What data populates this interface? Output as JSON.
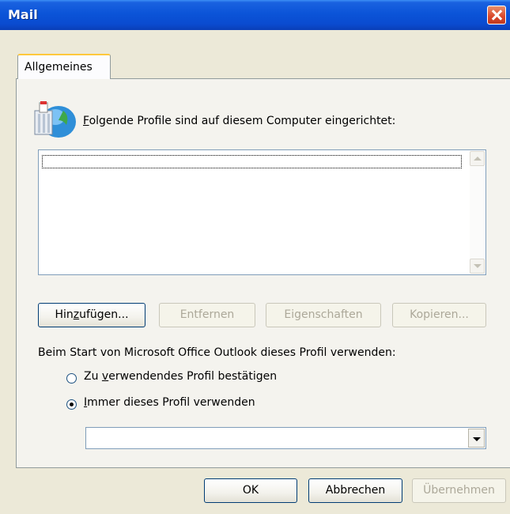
{
  "window": {
    "title": "Mail"
  },
  "tabs": [
    {
      "label": "Allgemeines"
    }
  ],
  "profiles": {
    "label": "Folgende Profile sind auf diesem Computer eingerichtet:",
    "items": []
  },
  "list_buttons": {
    "add": "Hinzufügen...",
    "remove": "Entfernen",
    "properties": "Eigenschaften",
    "copy": "Kopieren..."
  },
  "startup": {
    "label": "Beim Start von Microsoft Office Outlook dieses Profil verwenden:",
    "options": [
      {
        "label": "Zu verwendendes Profil bestätigen",
        "selected": false
      },
      {
        "label": "Immer dieses Profil verwenden",
        "selected": true
      }
    ],
    "profile_select_value": ""
  },
  "dialog_buttons": {
    "ok": "OK",
    "cancel": "Abbrechen",
    "apply": "Übernehmen"
  },
  "colors": {
    "titlebar": "#0b54d8",
    "dialog_bg": "#ece9d8",
    "close_button": "#d9462a",
    "tab_highlight": "#ffc83c"
  }
}
